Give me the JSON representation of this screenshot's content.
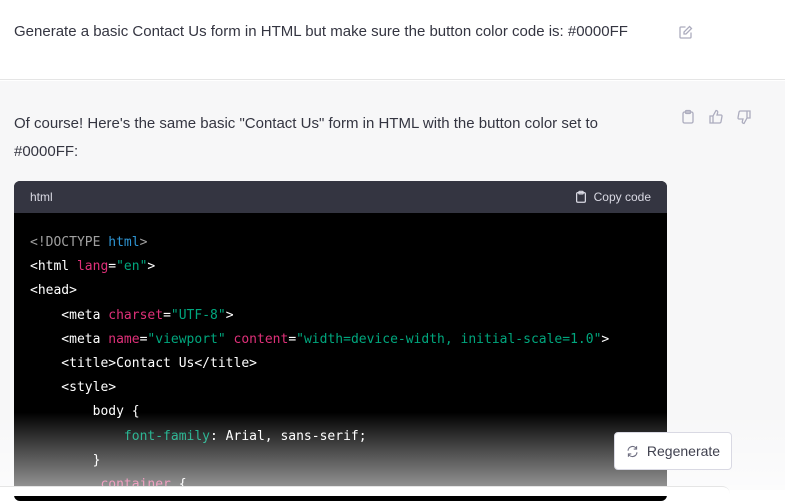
{
  "user_message": {
    "text": "Generate a basic Contact Us form in HTML but make sure the button color code is: #0000FF"
  },
  "assistant_message": {
    "text": "Of course! Here's the same basic \"Contact Us\" form in HTML with the button color set to #0000FF:",
    "code_block": {
      "language": "html",
      "copy_label": "Copy code",
      "lines": [
        [
          [
            "t-gray",
            "<!DOCTYPE "
          ],
          [
            "t-blue",
            "html"
          ],
          [
            "t-gray",
            ">"
          ]
        ],
        [
          [
            "t-w",
            "<html "
          ],
          [
            "t-attr",
            "lang"
          ],
          [
            "t-w",
            "="
          ],
          [
            "t-str",
            "\"en\""
          ],
          [
            "t-w",
            ">"
          ]
        ],
        [
          [
            "t-w",
            "<head>"
          ]
        ],
        [
          [
            "t-w",
            "    <meta "
          ],
          [
            "t-attr",
            "charset"
          ],
          [
            "t-w",
            "="
          ],
          [
            "t-str",
            "\"UTF-8\""
          ],
          [
            "t-w",
            ">"
          ]
        ],
        [
          [
            "t-w",
            "    <meta "
          ],
          [
            "t-attr",
            "name"
          ],
          [
            "t-w",
            "="
          ],
          [
            "t-str",
            "\"viewport\""
          ],
          [
            "t-w",
            " "
          ],
          [
            "t-attr",
            "content"
          ],
          [
            "t-w",
            "="
          ],
          [
            "t-str",
            "\"width=device-width, initial-scale=1.0\""
          ],
          [
            "t-w",
            ">"
          ]
        ],
        [
          [
            "t-w",
            "    <title>Contact Us</title>"
          ]
        ],
        [
          [
            "t-w",
            "    <style>"
          ]
        ],
        [
          [
            "t-w",
            "        body {"
          ]
        ],
        [
          [
            "t-str",
            "            font-family"
          ],
          [
            "t-w",
            ": Arial, sans-serif;"
          ]
        ],
        [
          [
            "t-w",
            "        }"
          ]
        ],
        [
          [
            "t-attr",
            "        .container"
          ],
          [
            "t-w",
            " {"
          ]
        ]
      ]
    }
  },
  "regenerate_label": "Regenerate",
  "colors": {
    "code_bg": "#000000",
    "code_header": "#343541",
    "attr": "#df3079",
    "string": "#00a67d",
    "keyword": "#2e95d3"
  }
}
